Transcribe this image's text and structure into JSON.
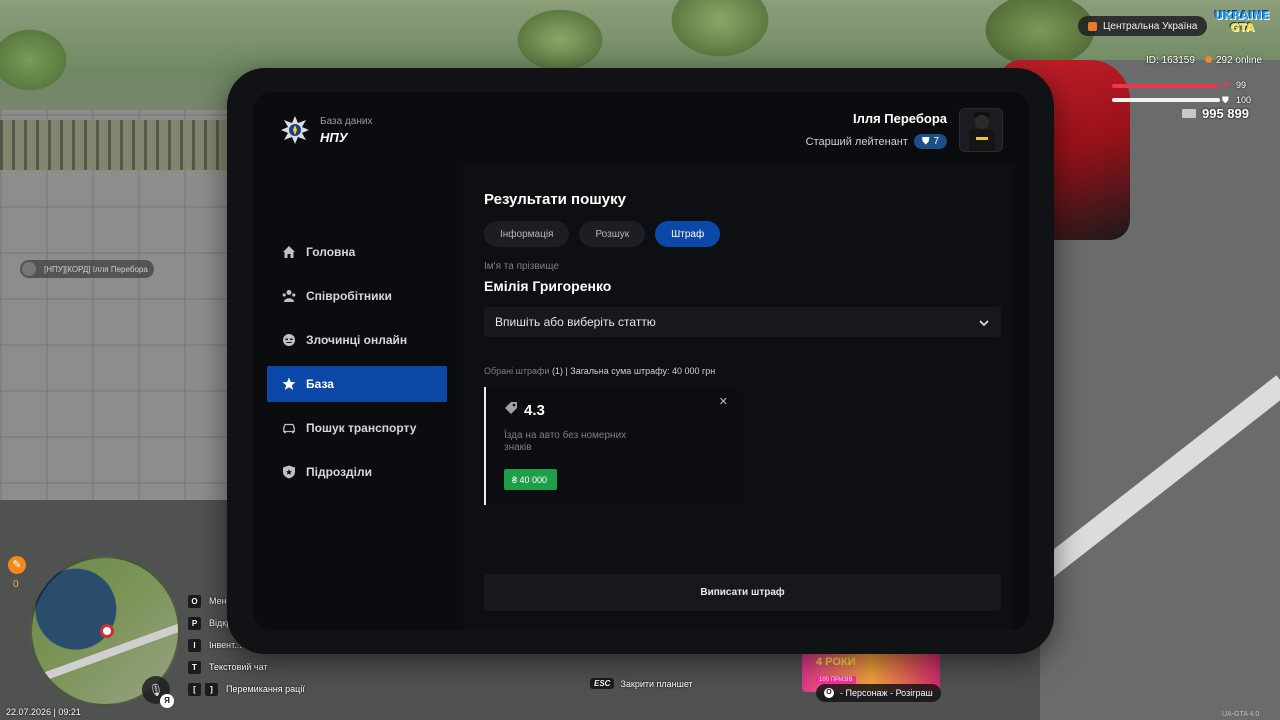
{
  "hud": {
    "region": "Центральна Україна",
    "logo_line1": "UKRAINE",
    "logo_line2": "GTA",
    "player_id": "ID: 163159",
    "online": "292 online",
    "health": "99",
    "health_level": 0.99,
    "armor": "100",
    "armor_level": 1.0,
    "money": "995 899",
    "nameplate": "[НПУ][КОРД] Ілля Перебора",
    "quest_count": "0",
    "mic_badge": "Я",
    "datetime": "22.07.2026 | 09:21",
    "keyhints": [
      {
        "keys": [
          "O"
        ],
        "label": "Меню"
      },
      {
        "keys": [
          "P"
        ],
        "label": "Відкр..."
      },
      {
        "keys": [
          "I"
        ],
        "label": "Інвент..."
      },
      {
        "keys": [
          "T"
        ],
        "label": "Текстовий чат"
      },
      {
        "keys": [
          "[",
          "]"
        ],
        "label": "Перемикання рації"
      }
    ],
    "esc_key": "ESC",
    "esc_label": "Закрити планшет",
    "promo_label": "4 РОКИ",
    "promo_sub": "100 ПРИЗІВ",
    "character_key": "O",
    "character_label": "- Персонаж - Розіграш",
    "version": "UA-GTA 4.0"
  },
  "tablet": {
    "brand_sub": "База даних",
    "brand_main": "НПУ",
    "profile_name": "Ілля Перебора",
    "profile_rank": "Старший лейтенант",
    "rank_level": "7",
    "nav": [
      {
        "label": "Головна",
        "icon": "home-icon"
      },
      {
        "label": "Співробітники",
        "icon": "staff-icon"
      },
      {
        "label": "Злочинці онлайн",
        "icon": "criminal-icon"
      },
      {
        "label": "База",
        "icon": "star-icon",
        "active": true
      },
      {
        "label": "Пошук транспорту",
        "icon": "car-icon"
      },
      {
        "label": "Підрозділи",
        "icon": "shield-icon"
      }
    ],
    "results_title": "Результати пошуку",
    "tabs": [
      {
        "label": "Інформація"
      },
      {
        "label": "Розшук"
      },
      {
        "label": "Штраф",
        "active": true
      }
    ],
    "name_label": "Ім'я та прізвище",
    "person_name": "Емілія Григоренко",
    "article_placeholder": "Впишіть або виберіть статтю",
    "summary_selected": "Обрані штрафи",
    "summary_rest": "(1) | Загальна сума штрафу: 40 000 грн",
    "fine": {
      "code": "4.3",
      "description": "Їзда на авто без номерних знаків",
      "amount": "₴ 40 000"
    },
    "submit_label": "Виписати штраф"
  },
  "colors": {
    "accent": "#0c48a8",
    "fine_green": "#1d9f4a",
    "health": "#e8384f"
  }
}
